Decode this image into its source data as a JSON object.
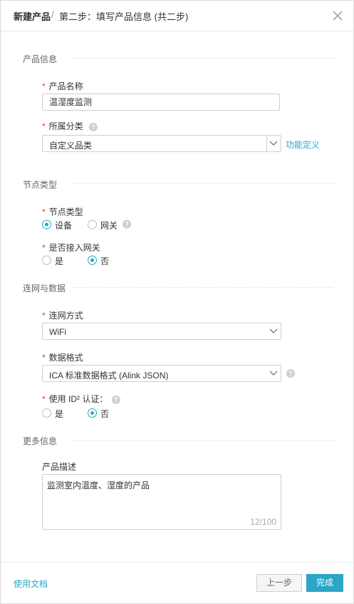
{
  "header": {
    "title": "新建产品",
    "separator": "/",
    "step": "第二步：填写产品信息 (共二步)"
  },
  "sections": {
    "product_info": "产品信息",
    "node_type": "节点类型",
    "network_data": "连网与数据",
    "more_info": "更多信息"
  },
  "required_mark": "*",
  "help_glyph": "?",
  "fields": {
    "product_name": {
      "label": "产品名称",
      "value": "温湿度监测"
    },
    "category": {
      "label": "所属分类",
      "value": "自定义品类",
      "link": "功能定义"
    },
    "node_type": {
      "label": "节点类型",
      "options": [
        "设备",
        "网关"
      ],
      "selected": "设备"
    },
    "gateway_access": {
      "label": "是否接入网关",
      "options": [
        "是",
        "否"
      ],
      "selected": "否"
    },
    "network_mode": {
      "label": "连网方式",
      "value": "WiFi"
    },
    "data_format": {
      "label": "数据格式",
      "value": "ICA 标准数据格式 (Alink JSON)"
    },
    "id2_auth": {
      "label": "使用 ID² 认证：",
      "options": [
        "是",
        "否"
      ],
      "selected": "否"
    },
    "description": {
      "label": "产品描述",
      "value": "监测室内温度、湿度的产品",
      "count": "12/100"
    }
  },
  "footer": {
    "docs_link": "使用文档",
    "prev_button": "上一步",
    "done_button": "完成"
  },
  "colors": {
    "accent": "#2ba6c6",
    "required": "#e0322b",
    "border": "#cfcfcf"
  }
}
